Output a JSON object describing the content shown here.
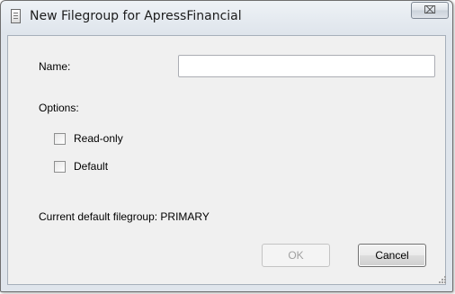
{
  "window": {
    "title": "New Filegroup for ApressFinancial",
    "close_glyph": "⌧"
  },
  "form": {
    "name_label": "Name:",
    "name_value": "",
    "options_label": "Options:",
    "readonly_label": "Read-only",
    "readonly_checked": false,
    "default_label": "Default",
    "default_checked": false,
    "current_default_text": "Current default filegroup: PRIMARY"
  },
  "buttons": {
    "ok_label": "OK",
    "ok_enabled": false,
    "cancel_label": "Cancel"
  },
  "icons": {
    "app": "document-icon",
    "close": "close-icon",
    "grip": "resize-grip-icon"
  }
}
